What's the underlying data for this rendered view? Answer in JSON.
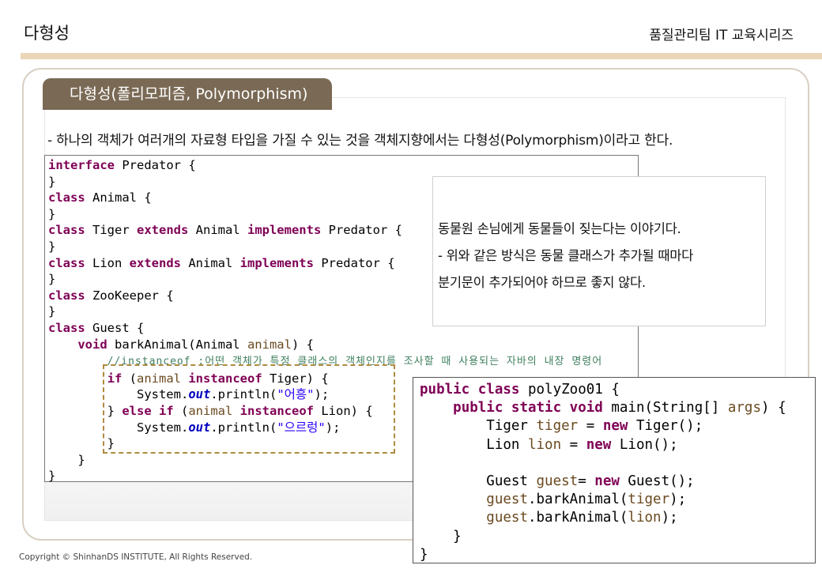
{
  "header": {
    "title": "다형성",
    "series": "품질관리팀 IT 교육시리즈"
  },
  "section": {
    "tab": "다형성(폴리모피즘, Polymorphism)",
    "description": "- 하나의 객체가 여러개의 자료형 타입을 가질 수 있는 것을 객체지향에서는 다형성(Polymorphism)이라고 한다."
  },
  "code_main": {
    "comment": "//instanceof :어떤 객체가 특정 클래스의 객체인지를 조사할 때 사용되는 자바의 내장 명령어",
    "str_roar_tiger": "\"어흥\"",
    "str_roar_lion": "\"으르렁\""
  },
  "note": {
    "line1": "동물원 손님에게 동물들이 짖는다는 이야기다.",
    "line2": "- 위와 같은 방식은 동물 클래스가 추가될 때마다",
    "line3": "분기문이 추가되어야 하므로 좋지 않다."
  },
  "footer": {
    "copyright": "Copyright © ShinhanDS INSTITUTE, All Rights Reserved."
  }
}
